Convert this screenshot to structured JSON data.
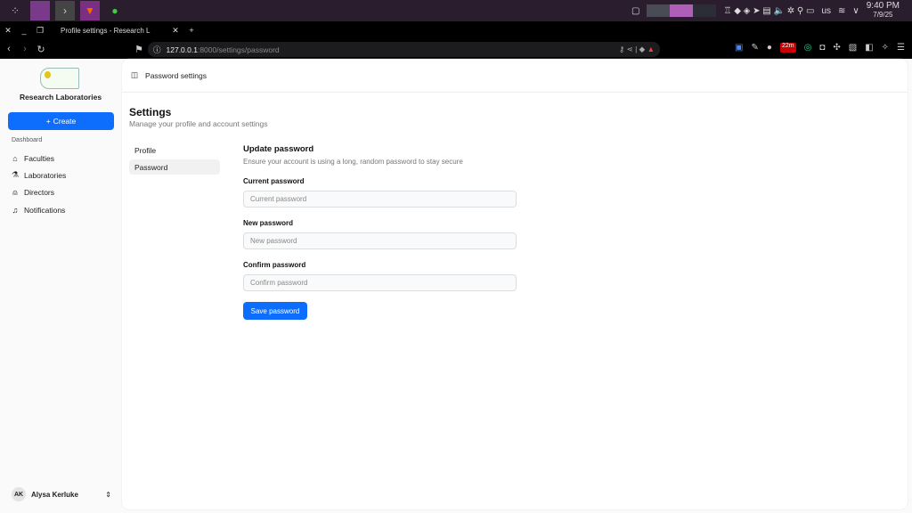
{
  "taskbar": {
    "clock_time": "9:40 PM",
    "clock_date": "7/9/25",
    "keyboard_layout": "us"
  },
  "browser": {
    "tab_title": "Profile settings - Research L",
    "url_host": "127.0.0.1",
    "url_path": ":8000/settings/password",
    "badge": "22m"
  },
  "sidebar": {
    "brand": "Research Laboratories",
    "create_label": "Create",
    "section": "Dashboard",
    "items": [
      {
        "label": "Faculties",
        "icon": "building-icon"
      },
      {
        "label": "Laboratories",
        "icon": "microscope-icon"
      },
      {
        "label": "Directors",
        "icon": "user-icon"
      },
      {
        "label": "Notifications",
        "icon": "bell-icon"
      }
    ],
    "user": {
      "initials": "AK",
      "name": "Alysa Kerluke"
    }
  },
  "header": {
    "title": "Password settings"
  },
  "settings": {
    "title": "Settings",
    "subtitle": "Manage your profile and account settings",
    "nav": [
      {
        "label": "Profile"
      },
      {
        "label": "Password"
      }
    ]
  },
  "form": {
    "title": "Update password",
    "description": "Ensure your account is using a long, random password to stay secure",
    "fields": [
      {
        "label": "Current password",
        "placeholder": "Current password"
      },
      {
        "label": "New password",
        "placeholder": "New password"
      },
      {
        "label": "Confirm password",
        "placeholder": "Confirm password"
      }
    ],
    "submit": "Save password"
  },
  "colors": {
    "accent": "#0d6efd",
    "taskbar": "#2a1d2e"
  }
}
